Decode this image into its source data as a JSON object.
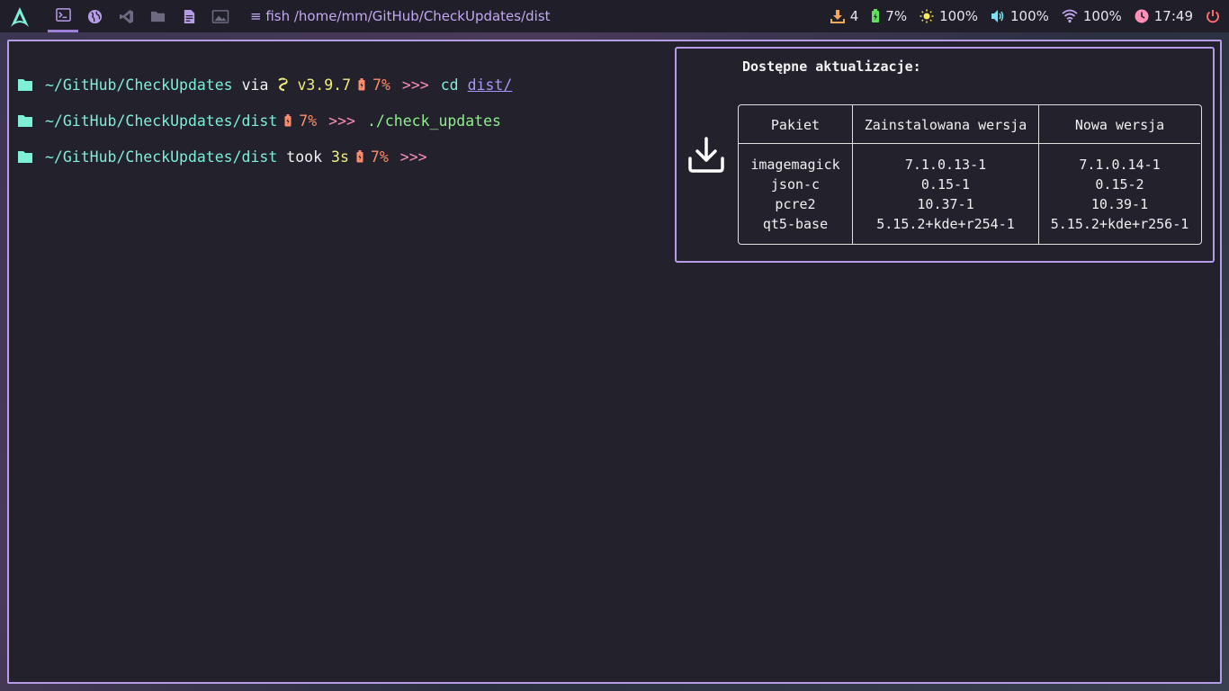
{
  "topbar": {
    "window_title": "≡ fish /home/mm/GitHub/CheckUpdates/dist",
    "workspaces": [
      "terminal-icon",
      "globe-icon",
      "vscode-icon",
      "folder-icon",
      "document-icon",
      "image-icon"
    ],
    "tray": {
      "updates_count": "4",
      "battery": "7%",
      "brightness": "100%",
      "volume": "100%",
      "wifi": "100%",
      "clock": "17:49"
    }
  },
  "terminal": {
    "lines": [
      {
        "path": "~/GitHub/CheckUpdates",
        "via": "via",
        "python_version": "v3.9.7",
        "battery": "7%",
        "prompt": ">>>",
        "command": "cd",
        "argument": "dist/"
      },
      {
        "path": "~/GitHub/CheckUpdates/dist",
        "battery": "7%",
        "prompt": ">>>",
        "command": "./check_updates"
      },
      {
        "path": "~/GitHub/CheckUpdates/dist",
        "took": "took",
        "duration": "3s",
        "battery": "7%",
        "prompt": ">>>"
      }
    ]
  },
  "notification": {
    "title": "Dostępne aktualizacje:",
    "headers": [
      "Pakiet",
      "Zainstalowana wersja",
      "Nowa wersja"
    ],
    "rows": [
      [
        "imagemagick",
        "7.1.0.13-1",
        "7.1.0.14-1"
      ],
      [
        "json-c",
        "0.15-1",
        "0.15-2"
      ],
      [
        "pcre2",
        "10.37-1",
        "10.39-1"
      ],
      [
        "qt5-base",
        "5.15.2+kde+r254-1",
        "5.15.2+kde+r256-1"
      ]
    ]
  }
}
